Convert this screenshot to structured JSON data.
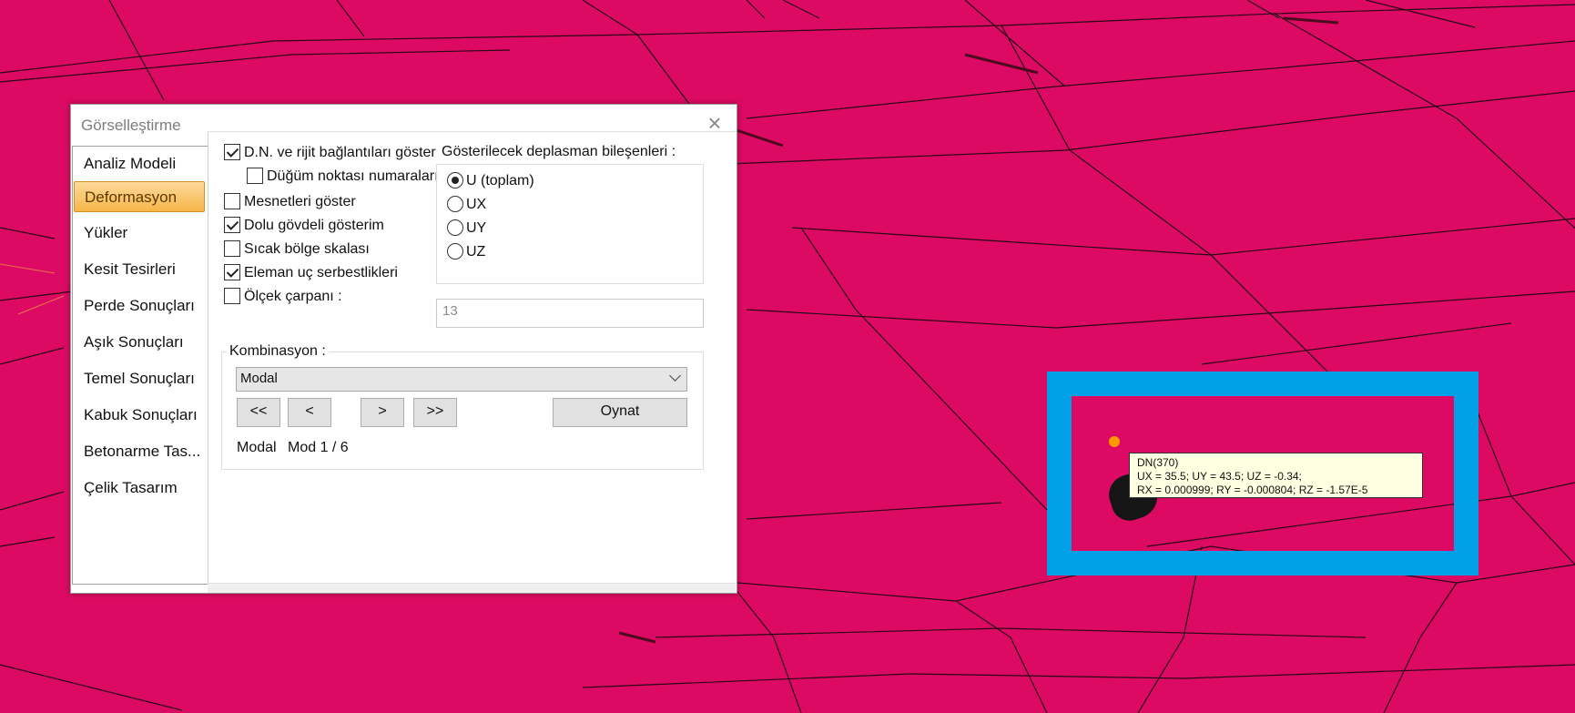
{
  "colors": {
    "background": "#dc0a62",
    "mesh_line": "#2a0716",
    "highlight": "#00a0e6",
    "active_tab": "#f7b649",
    "node": "#ff9900",
    "tooltip_bg": "#ffffe1"
  },
  "dialog": {
    "title": "Görselleştirme",
    "close_icon": "close-icon",
    "sidebar": {
      "items": [
        {
          "label": "Analiz Modeli",
          "active": false
        },
        {
          "label": "Deformasyon",
          "active": true
        },
        {
          "label": "Yükler",
          "active": false
        },
        {
          "label": "Kesit Tesirleri",
          "active": false
        },
        {
          "label": "Perde Sonuçları",
          "active": false
        },
        {
          "label": "Aşık Sonuçları",
          "active": false
        },
        {
          "label": "Temel Sonuçları",
          "active": false
        },
        {
          "label": "Kabuk Sonuçları",
          "active": false
        },
        {
          "label": "Betonarme Tas...",
          "active": false
        },
        {
          "label": "Çelik Tasarım",
          "active": false
        }
      ]
    },
    "options": [
      {
        "label": "D.N. ve rijit bağlantıları göster",
        "checked": true
      },
      {
        "label": "Düğüm noktası numaraları",
        "checked": false
      },
      {
        "label": "Mesnetleri göster",
        "checked": false
      },
      {
        "label": "Dolu gövdeli gösterim",
        "checked": true
      },
      {
        "label": "Sıcak bölge skalası",
        "checked": false
      },
      {
        "label": "Eleman uç serbestlikleri",
        "checked": true
      },
      {
        "label": "Ölçek çarpanı :",
        "checked": false
      }
    ],
    "scale_value": "13",
    "displacement": {
      "title": "Gösterilecek deplasman bileşenleri :",
      "choices": [
        {
          "label": "U (toplam)",
          "selected": true
        },
        {
          "label": "UX",
          "selected": false
        },
        {
          "label": "UY",
          "selected": false
        },
        {
          "label": "UZ",
          "selected": false
        }
      ]
    },
    "combination": {
      "title": "Kombinasyon :",
      "selected": "Modal",
      "buttons": {
        "first": "<<",
        "prev": "<",
        "next": ">",
        "last": ">>",
        "play": "Oynat"
      },
      "status_type": "Modal",
      "status_mode": "Mod 1 / 6"
    }
  },
  "tooltip": {
    "line1": "DN(370)",
    "line2": "UX = 35.5; UY = 43.5; UZ = -0.34;",
    "line3": "RX = 0.000999; RY = -0.000804; RZ = -1.57E-5"
  }
}
